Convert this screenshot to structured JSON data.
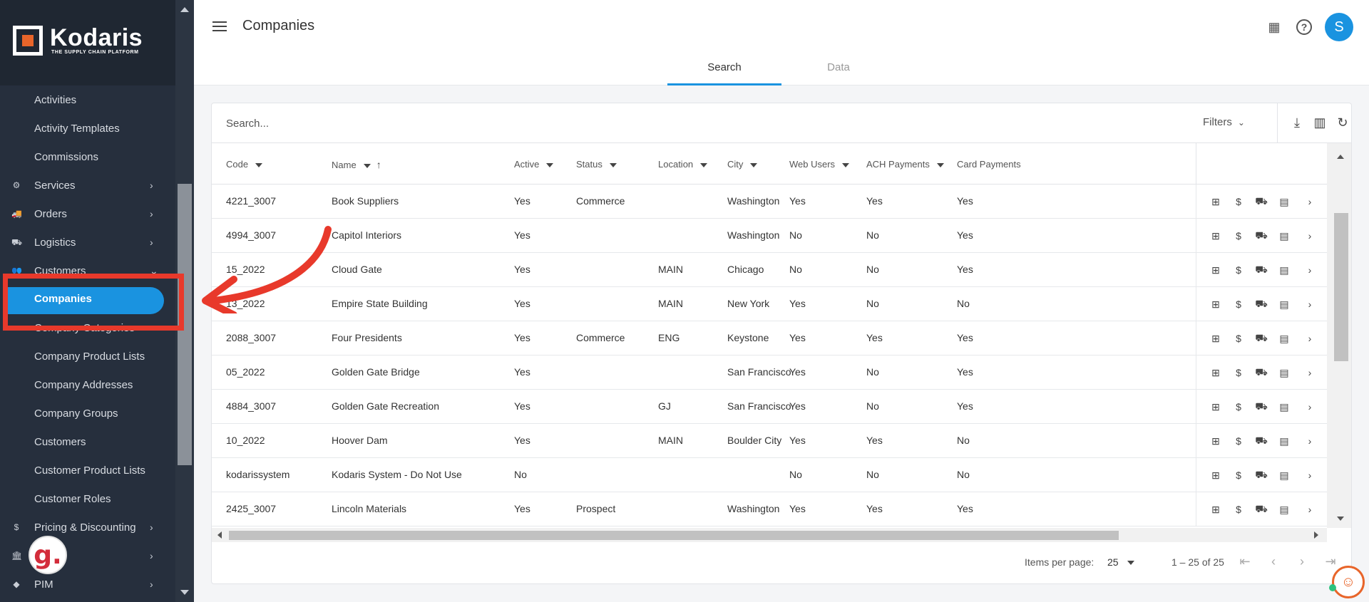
{
  "brand": {
    "name": "Kodaris",
    "tagline": "THE SUPPLY CHAIN PLATFORM"
  },
  "sidebar": {
    "items": [
      {
        "label": "Activities",
        "type": "sub"
      },
      {
        "label": "Activity Templates",
        "type": "sub"
      },
      {
        "label": "Commissions",
        "type": "sub"
      },
      {
        "label": "Services",
        "type": "top",
        "icon": "services-icon",
        "glyph": "⚙",
        "chevron": "›"
      },
      {
        "label": "Orders",
        "type": "top",
        "icon": "orders-icon",
        "glyph": "🚚",
        "chevron": "›"
      },
      {
        "label": "Logistics",
        "type": "top",
        "icon": "logistics-icon",
        "glyph": "⛟",
        "chevron": "›"
      },
      {
        "label": "Customers",
        "type": "top",
        "icon": "customers-icon",
        "glyph": "👥",
        "chevron": "⌄"
      },
      {
        "label": "Companies",
        "type": "active"
      },
      {
        "label": "Company Categories",
        "type": "sub"
      },
      {
        "label": "Company Product Lists",
        "type": "sub"
      },
      {
        "label": "Company Addresses",
        "type": "sub"
      },
      {
        "label": "Company Groups",
        "type": "sub"
      },
      {
        "label": "Customers",
        "type": "sub"
      },
      {
        "label": "Customer Product Lists",
        "type": "sub"
      },
      {
        "label": "Customer Roles",
        "type": "sub"
      },
      {
        "label": "Pricing & Discounting",
        "type": "top",
        "icon": "dollar-icon",
        "glyph": "$",
        "chevron": "›"
      },
      {
        "label": "",
        "type": "top",
        "icon": "bank-icon",
        "glyph": "🏛",
        "chevron": "›"
      },
      {
        "label": "PIM",
        "type": "top",
        "icon": "tag-icon",
        "glyph": "◆",
        "chevron": "›"
      }
    ]
  },
  "header": {
    "title": "Companies",
    "avatar_initial": "S"
  },
  "tabs": [
    {
      "label": "Search",
      "active": true
    },
    {
      "label": "Data",
      "active": false
    }
  ],
  "search": {
    "placeholder": "Search...",
    "filters_label": "Filters"
  },
  "table": {
    "columns": [
      "Code",
      "Name",
      "Active",
      "Status",
      "Location",
      "City",
      "Web Users",
      "ACH Payments",
      "Card Payments"
    ],
    "rows": [
      [
        "4221_3007",
        "Book Suppliers",
        "Yes",
        "Commerce",
        "",
        "Washington",
        "Yes",
        "Yes",
        "Yes"
      ],
      [
        "4994_3007",
        "Capitol Interiors",
        "Yes",
        "",
        "",
        "Washington",
        "No",
        "No",
        "Yes"
      ],
      [
        "15_2022",
        "Cloud Gate",
        "Yes",
        "",
        "MAIN",
        "Chicago",
        "No",
        "No",
        "Yes"
      ],
      [
        "13_2022",
        "Empire State Building",
        "Yes",
        "",
        "MAIN",
        "New York",
        "Yes",
        "No",
        "No"
      ],
      [
        "2088_3007",
        "Four Presidents",
        "Yes",
        "Commerce",
        "ENG",
        "Keystone",
        "Yes",
        "Yes",
        "Yes"
      ],
      [
        "05_2022",
        "Golden Gate Bridge",
        "Yes",
        "",
        "",
        "San Francisco",
        "Yes",
        "No",
        "Yes"
      ],
      [
        "4884_3007",
        "Golden Gate Recreation",
        "Yes",
        "",
        "GJ",
        "San Francisco",
        "Yes",
        "No",
        "Yes"
      ],
      [
        "10_2022",
        "Hoover Dam",
        "Yes",
        "",
        "MAIN",
        "Boulder City",
        "Yes",
        "Yes",
        "No"
      ],
      [
        "kodarissystem",
        "Kodaris System - Do Not Use",
        "No",
        "",
        "",
        "",
        "No",
        "No",
        "No"
      ],
      [
        "2425_3007",
        "Lincoln Materials",
        "Yes",
        "Prospect",
        "",
        "Washington",
        "Yes",
        "Yes",
        "Yes"
      ]
    ]
  },
  "paginator": {
    "label": "Items per page:",
    "page_size": "25",
    "range": "1 – 25 of 25"
  },
  "colors": {
    "accent": "#1a93e0",
    "sidebar": "#262f3d",
    "highlight": "#e8392b"
  }
}
